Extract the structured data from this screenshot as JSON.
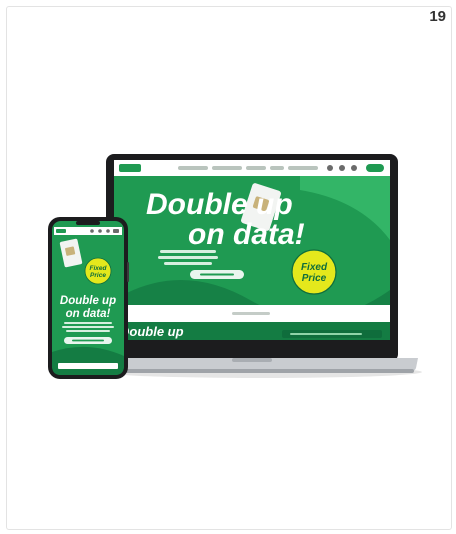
{
  "page": {
    "number": "19"
  },
  "laptop_site": {
    "headline_line1": "Double up",
    "headline_line2": "on data!",
    "badge_line1": "Fixed",
    "badge_line2": "Price",
    "footer_headline": "Double up"
  },
  "phone_site": {
    "headline_line1": "Double up",
    "headline_line2": "on data!",
    "badge_line1": "Fixed",
    "badge_line2": "Price"
  },
  "colors": {
    "brand_green": "#1f9a52",
    "deep_green": "#0f6d3c",
    "light_green": "#3cc170",
    "badge_yellow": "#e4e81c",
    "device_dark": "#1c1c1e",
    "device_silver": "#c9ccd0"
  }
}
